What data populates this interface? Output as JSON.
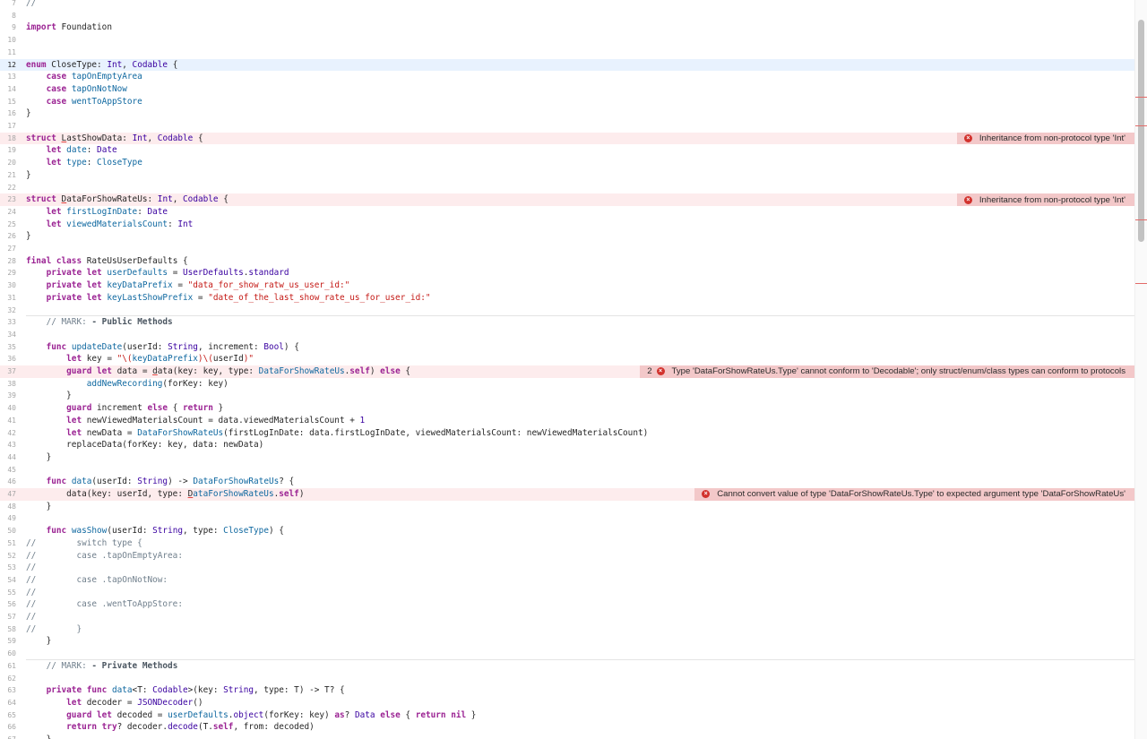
{
  "editor": {
    "first_line_number": 7,
    "current_line_number": 12,
    "lines": [
      [
        [
          "cm",
          "//"
        ]
      ],
      [],
      [
        [
          "kw",
          "import"
        ],
        [
          "pl",
          " Foundation"
        ]
      ],
      [],
      [],
      [
        [
          "kw",
          "enum"
        ],
        [
          "pl",
          " CloseType: "
        ],
        [
          "ty",
          "Int"
        ],
        [
          "pl",
          ", "
        ],
        [
          "ty",
          "Codable"
        ],
        [
          "pl",
          " {"
        ]
      ],
      [
        [
          "pl",
          "    "
        ],
        [
          "kw",
          "case"
        ],
        [
          "pl",
          " "
        ],
        [
          "fn",
          "tapOnEmptyArea"
        ]
      ],
      [
        [
          "pl",
          "    "
        ],
        [
          "kw",
          "case"
        ],
        [
          "pl",
          " "
        ],
        [
          "fn",
          "tapOnNotNow"
        ]
      ],
      [
        [
          "pl",
          "    "
        ],
        [
          "kw",
          "case"
        ],
        [
          "pl",
          " "
        ],
        [
          "fn",
          "wentToAppStore"
        ]
      ],
      [
        [
          "pl",
          "}"
        ]
      ],
      [],
      [
        [
          "kw",
          "struct"
        ],
        [
          "pl",
          " "
        ],
        [
          "er",
          "L"
        ],
        [
          "pl",
          "astShowData: "
        ],
        [
          "ty",
          "Int"
        ],
        [
          "pl",
          ", "
        ],
        [
          "ty",
          "Codable"
        ],
        [
          "pl",
          " {"
        ]
      ],
      [
        [
          "pl",
          "    "
        ],
        [
          "kw",
          "let"
        ],
        [
          "pl",
          " "
        ],
        [
          "fn",
          "date"
        ],
        [
          "pl",
          ": "
        ],
        [
          "ty",
          "Date"
        ]
      ],
      [
        [
          "pl",
          "    "
        ],
        [
          "kw",
          "let"
        ],
        [
          "pl",
          " "
        ],
        [
          "fn",
          "type"
        ],
        [
          "pl",
          ": "
        ],
        [
          "fn",
          "CloseType"
        ]
      ],
      [
        [
          "pl",
          "}"
        ]
      ],
      [],
      [
        [
          "kw",
          "struct"
        ],
        [
          "pl",
          " "
        ],
        [
          "er",
          "D"
        ],
        [
          "pl",
          "ataForShowRateUs: "
        ],
        [
          "ty",
          "Int"
        ],
        [
          "pl",
          ", "
        ],
        [
          "ty",
          "Codable"
        ],
        [
          "pl",
          " {"
        ]
      ],
      [
        [
          "pl",
          "    "
        ],
        [
          "kw",
          "let"
        ],
        [
          "pl",
          " "
        ],
        [
          "fn",
          "firstLogInDate"
        ],
        [
          "pl",
          ": "
        ],
        [
          "ty",
          "Date"
        ]
      ],
      [
        [
          "pl",
          "    "
        ],
        [
          "kw",
          "let"
        ],
        [
          "pl",
          " "
        ],
        [
          "fn",
          "viewedMaterialsCount"
        ],
        [
          "pl",
          ": "
        ],
        [
          "ty",
          "Int"
        ]
      ],
      [
        [
          "pl",
          "}"
        ]
      ],
      [],
      [
        [
          "kw",
          "final class"
        ],
        [
          "pl",
          " RateUsUserDefaults {"
        ]
      ],
      [
        [
          "pl",
          "    "
        ],
        [
          "kw",
          "private let"
        ],
        [
          "pl",
          " "
        ],
        [
          "fn",
          "userDefaults"
        ],
        [
          "pl",
          " = "
        ],
        [
          "ty",
          "UserDefaults"
        ],
        [
          "pl",
          "."
        ],
        [
          "ty",
          "standard"
        ]
      ],
      [
        [
          "pl",
          "    "
        ],
        [
          "kw",
          "private let"
        ],
        [
          "pl",
          " "
        ],
        [
          "fn",
          "keyDataPrefix"
        ],
        [
          "pl",
          " = "
        ],
        [
          "st",
          "\"data_for_show_ratw_us_user_id:\""
        ]
      ],
      [
        [
          "pl",
          "    "
        ],
        [
          "kw",
          "private let"
        ],
        [
          "pl",
          " "
        ],
        [
          "fn",
          "keyLastShowPrefix"
        ],
        [
          "pl",
          " = "
        ],
        [
          "st",
          "\"date_of_the_last_show_rate_us_for_user_id:\""
        ]
      ],
      [],
      [
        [
          "pl",
          "    "
        ],
        [
          "cm",
          "// MARK: "
        ],
        [
          "cb",
          "- Public Methods"
        ]
      ],
      [],
      [
        [
          "pl",
          "    "
        ],
        [
          "kw",
          "func"
        ],
        [
          "pl",
          " "
        ],
        [
          "fn",
          "updateDate"
        ],
        [
          "pl",
          "(userId: "
        ],
        [
          "ty",
          "String"
        ],
        [
          "pl",
          ", increment: "
        ],
        [
          "ty",
          "Bool"
        ],
        [
          "pl",
          ") {"
        ]
      ],
      [
        [
          "pl",
          "        "
        ],
        [
          "kw",
          "let"
        ],
        [
          "pl",
          " key = "
        ],
        [
          "st",
          "\"\\("
        ],
        [
          "fn",
          "keyDataPrefix"
        ],
        [
          "st",
          ")\\("
        ],
        [
          "pl",
          "userId"
        ],
        [
          "st",
          ")\""
        ]
      ],
      [
        [
          "pl",
          "        "
        ],
        [
          "kw",
          "guard let"
        ],
        [
          "pl",
          " data = "
        ],
        [
          "er",
          "d"
        ],
        [
          "pl",
          "ata(key: key, type: "
        ],
        [
          "fn",
          "DataForShowRateUs"
        ],
        [
          "pl",
          "."
        ],
        [
          "kw",
          "self"
        ],
        [
          "pl",
          ") "
        ],
        [
          "kw",
          "else"
        ],
        [
          "pl",
          " {"
        ]
      ],
      [
        [
          "pl",
          "            "
        ],
        [
          "fn",
          "addNewRecording"
        ],
        [
          "pl",
          "(forKey: key)"
        ]
      ],
      [
        [
          "pl",
          "        }"
        ]
      ],
      [
        [
          "pl",
          "        "
        ],
        [
          "kw",
          "guard"
        ],
        [
          "pl",
          " increment "
        ],
        [
          "kw",
          "else"
        ],
        [
          "pl",
          " { "
        ],
        [
          "kw",
          "return"
        ],
        [
          "pl",
          " }"
        ]
      ],
      [
        [
          "pl",
          "        "
        ],
        [
          "kw",
          "let"
        ],
        [
          "pl",
          " newViewedMaterialsCount = data.viewedMaterialsCount + "
        ],
        [
          "ty",
          "1"
        ]
      ],
      [
        [
          "pl",
          "        "
        ],
        [
          "kw",
          "let"
        ],
        [
          "pl",
          " newData = "
        ],
        [
          "fn",
          "DataForShowRateUs"
        ],
        [
          "pl",
          "(firstLogInDate: data.firstLogInDate, viewedMaterialsCount: newViewedMaterialsCount)"
        ]
      ],
      [
        [
          "pl",
          "        replaceData(forKey: key, data: newData)"
        ]
      ],
      [
        [
          "pl",
          "    }"
        ]
      ],
      [],
      [
        [
          "pl",
          "    "
        ],
        [
          "kw",
          "func"
        ],
        [
          "pl",
          " "
        ],
        [
          "fn",
          "data"
        ],
        [
          "pl",
          "(userId: "
        ],
        [
          "ty",
          "String"
        ],
        [
          "pl",
          ") -> "
        ],
        [
          "fn",
          "DataForShowRateUs"
        ],
        [
          "pl",
          "? {"
        ]
      ],
      [
        [
          "pl",
          "        data(key: userId, type: "
        ],
        [
          "er",
          "D"
        ],
        [
          "fn",
          "ataForShowRateUs"
        ],
        [
          "pl",
          "."
        ],
        [
          "kw",
          "self"
        ],
        [
          "pl",
          ")"
        ]
      ],
      [
        [
          "pl",
          "    }"
        ]
      ],
      [],
      [
        [
          "pl",
          "    "
        ],
        [
          "kw",
          "func"
        ],
        [
          "pl",
          " "
        ],
        [
          "fn",
          "wasShow"
        ],
        [
          "pl",
          "(userId: "
        ],
        [
          "ty",
          "String"
        ],
        [
          "pl",
          ", type: "
        ],
        [
          "fn",
          "CloseType"
        ],
        [
          "pl",
          ") {"
        ]
      ],
      [
        [
          "cm",
          "//        switch type {"
        ]
      ],
      [
        [
          "cm",
          "//        case .tapOnEmptyArea:"
        ]
      ],
      [
        [
          "cm",
          "//"
        ]
      ],
      [
        [
          "cm",
          "//        case .tapOnNotNow:"
        ]
      ],
      [
        [
          "cm",
          "//"
        ]
      ],
      [
        [
          "cm",
          "//        case .wentToAppStore:"
        ]
      ],
      [
        [
          "cm",
          "//"
        ]
      ],
      [
        [
          "cm",
          "//        }"
        ]
      ],
      [
        [
          "pl",
          "    }"
        ]
      ],
      [],
      [
        [
          "pl",
          "    "
        ],
        [
          "cm",
          "// MARK: "
        ],
        [
          "cb",
          "- Private Methods"
        ]
      ],
      [],
      [
        [
          "pl",
          "    "
        ],
        [
          "kw",
          "private func"
        ],
        [
          "pl",
          " "
        ],
        [
          "fn",
          "data"
        ],
        [
          "pl",
          "<T: "
        ],
        [
          "ty",
          "Codable"
        ],
        [
          "pl",
          ">(key: "
        ],
        [
          "ty",
          "String"
        ],
        [
          "pl",
          ", type: T) -> T? {"
        ]
      ],
      [
        [
          "pl",
          "        "
        ],
        [
          "kw",
          "let"
        ],
        [
          "pl",
          " decoder = "
        ],
        [
          "ty",
          "JSONDecoder"
        ],
        [
          "pl",
          "()"
        ]
      ],
      [
        [
          "pl",
          "        "
        ],
        [
          "kw",
          "guard let"
        ],
        [
          "pl",
          " decoded = "
        ],
        [
          "fn",
          "userDefaults"
        ],
        [
          "pl",
          "."
        ],
        [
          "ty",
          "object"
        ],
        [
          "pl",
          "(forKey: key) "
        ],
        [
          "kw",
          "as"
        ],
        [
          "pl",
          "? "
        ],
        [
          "ty",
          "Data"
        ],
        [
          "pl",
          " "
        ],
        [
          "kw",
          "else"
        ],
        [
          "pl",
          " { "
        ],
        [
          "kw",
          "return nil"
        ],
        [
          "pl",
          " }"
        ]
      ],
      [
        [
          "pl",
          "        "
        ],
        [
          "kw",
          "return try"
        ],
        [
          "pl",
          "? decoder."
        ],
        [
          "ty",
          "decode"
        ],
        [
          "pl",
          "(T."
        ],
        [
          "kw",
          "self"
        ],
        [
          "pl",
          ", from: decoded)"
        ]
      ],
      [
        [
          "pl",
          "    }"
        ]
      ]
    ],
    "mark_separator_lines": [
      33,
      61
    ],
    "issues": [
      {
        "line": 18,
        "count": "",
        "message": "Inheritance from non-protocol type 'Int'"
      },
      {
        "line": 23,
        "count": "",
        "message": "Inheritance from non-protocol type 'Int'"
      },
      {
        "line": 37,
        "count": "2",
        "message": "Type 'DataForShowRateUs.Type' cannot conform to 'Decodable'; only struct/enum/class types can conform to protocols"
      },
      {
        "line": 47,
        "count": "",
        "message": "Cannot convert value of type 'DataForShowRateUs.Type' to expected argument type 'DataForShowRateUs'"
      }
    ],
    "error_icon": "error-circle-icon",
    "colors": {
      "keyword": "#9b2393",
      "type": "#3900a0",
      "identifier": "#0f68a0",
      "string": "#c41a16",
      "comment": "#707f8c",
      "current_line": "#e8f2fe",
      "error_line": "#fdeced",
      "issue_badge": "#f3c8c9",
      "error_icon": "#d2322d"
    }
  }
}
